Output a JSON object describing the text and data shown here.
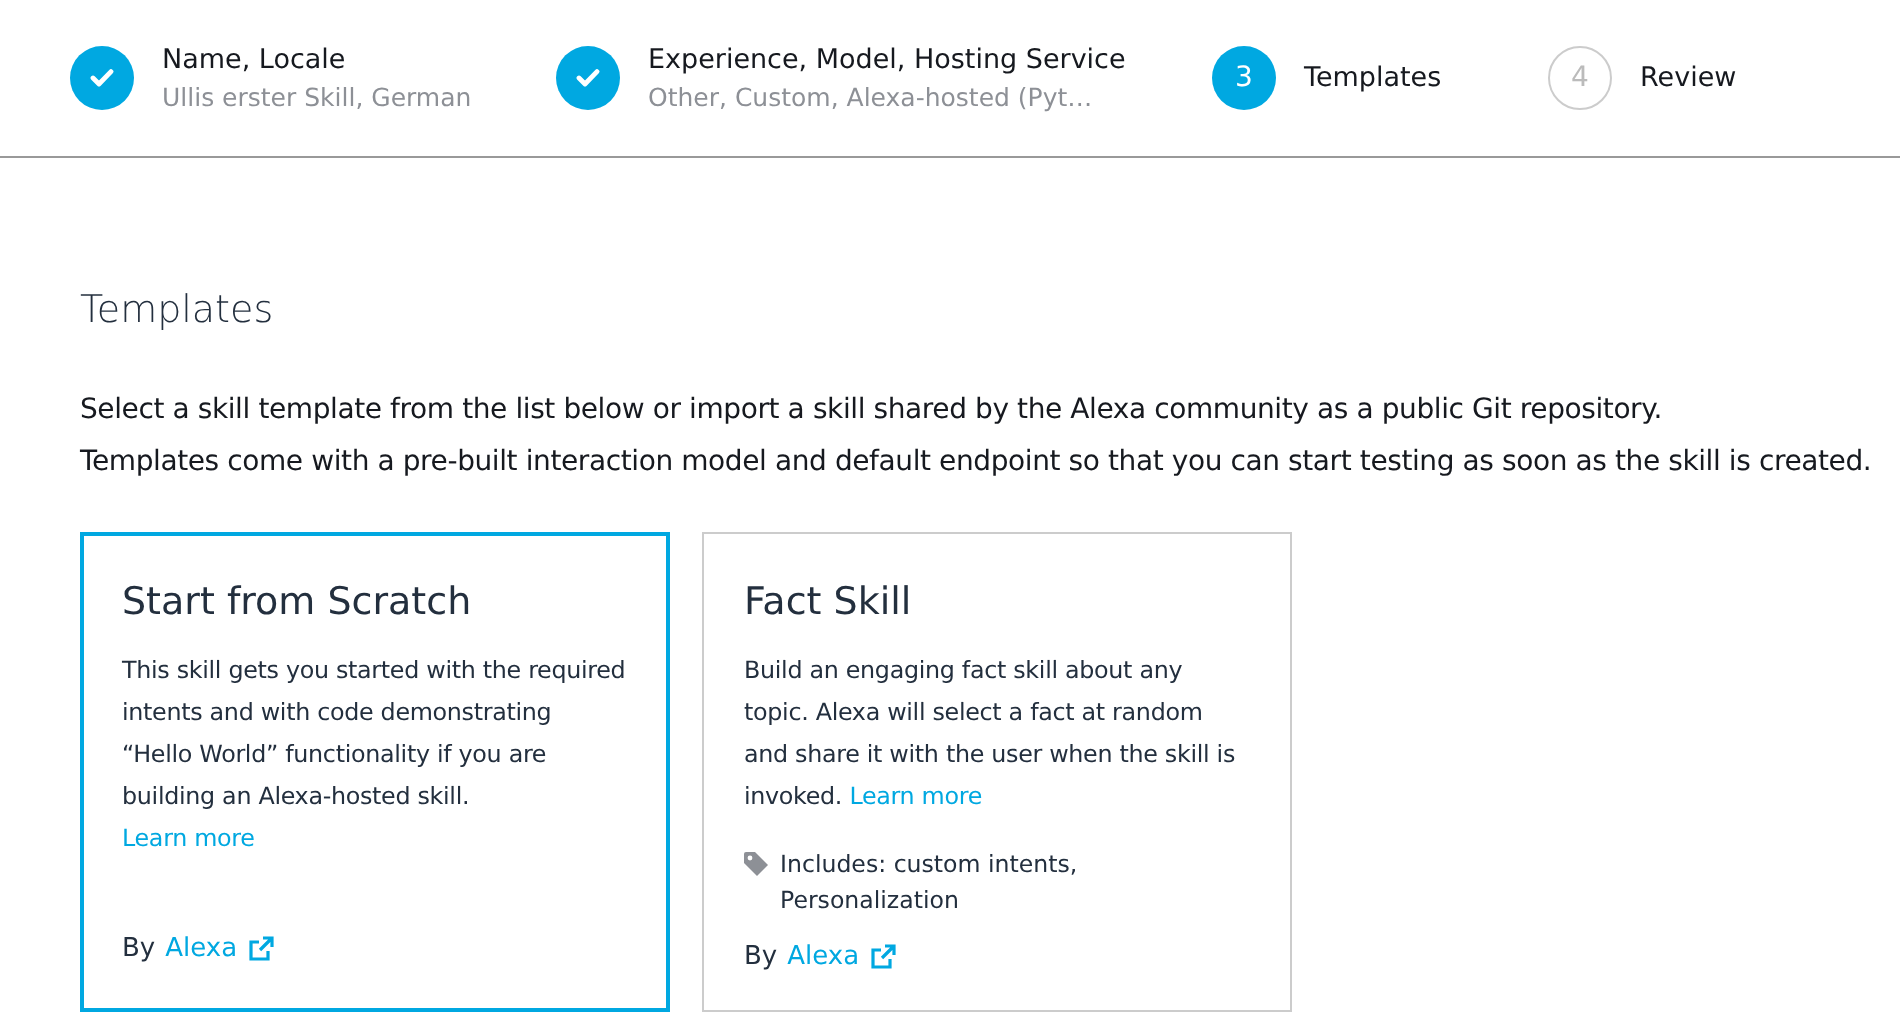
{
  "steps": [
    {
      "title": "Name, Locale",
      "subtitle": "Ullis erster Skill, German",
      "completed": true
    },
    {
      "title": "Experience, Model, Hosting Service",
      "subtitle": "Other, Custom, Alexa-hosted (Pyt…",
      "completed": true
    },
    {
      "number": "3",
      "title": "Templates",
      "completed": false,
      "current": true
    },
    {
      "number": "4",
      "title": "Review",
      "completed": false,
      "current": false
    }
  ],
  "section": {
    "heading": "Templates",
    "intro": [
      "Select a skill template from the list below or import a skill shared by the Alexa community as a public Git repository.",
      "Templates come with a pre-built interaction model and default endpoint so that you can start testing as soon as the skill is created."
    ]
  },
  "templates": [
    {
      "title": "Start from Scratch",
      "description": "This skill gets you started with the required intents and with code demonstrating “Hello World” functionality if you are building an Alexa-hosted skill.",
      "learn_more": "Learn more",
      "by": "By",
      "author": "Alexa",
      "selected": true
    },
    {
      "title": "Fact Skill",
      "description": "Build an engaging fact skill about any topic. Alexa will select a fact at random and share it with the user when the skill is invoked.",
      "learn_more": "Learn more",
      "includes": "Includes: custom intents, Personalization",
      "by": "By",
      "author": "Alexa",
      "selected": false
    }
  ]
}
